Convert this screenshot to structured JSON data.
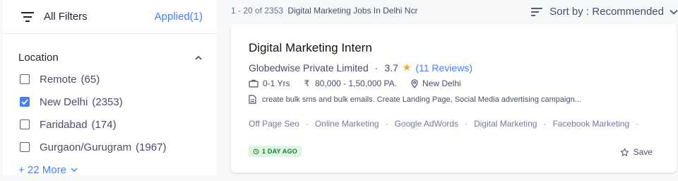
{
  "filters": {
    "title": "All Filters",
    "applied": "Applied(1)"
  },
  "location": {
    "title": "Location",
    "options": [
      {
        "label": "Remote",
        "count": "(65)",
        "checked": false
      },
      {
        "label": "New Delhi",
        "count": "(2353)",
        "checked": true
      },
      {
        "label": "Faridabad",
        "count": "(174)",
        "checked": false
      },
      {
        "label": "Gurgaon/Gurugram",
        "count": "(1967)",
        "checked": false
      }
    ],
    "more": "+ 22 More"
  },
  "results": {
    "range": "1 - 20 of 2353",
    "query": "Digital Marketing Jobs In Delhi Ncr"
  },
  "sort": {
    "label": "Sort by : Recommended"
  },
  "job": {
    "title": "Digital Marketing Intern",
    "company": "Globedwise Private Limited",
    "rating": "3.7",
    "reviews": "(11 Reviews)",
    "experience": "0-1 Yrs",
    "salary": "80,000 - 1,50,000 PA.",
    "location": "New Delhi",
    "description": "create bulk sms and bulk emails. Create Landing Page, Social Media advertising campaign...",
    "tags": [
      "Off Page Seo",
      "Online Marketing",
      "Google AdWords",
      "Digital Marketing",
      "Facebook Marketing"
    ],
    "posted": "1 DAY AGO",
    "save": "Save"
  },
  "colors": {
    "accent": "#457eff",
    "star": "#f5a623",
    "badge_bg": "#dff5e3",
    "badge_text": "#1a7a37"
  }
}
